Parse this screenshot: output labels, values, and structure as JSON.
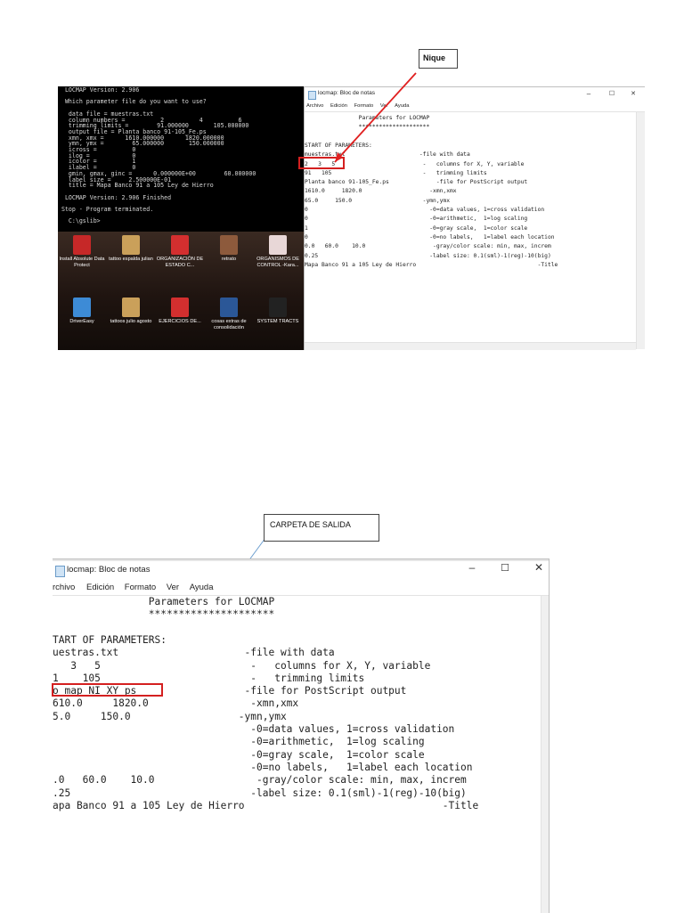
{
  "top_screenshot": {
    "console": {
      "lines": [
        "  LOCMAP Version: 2.906",
        "",
        "  Which parameter file do you want to use?",
        "",
        "   data file = muestras.txt",
        "   column numbers =          2          4          6",
        "   trimming limits =        91.000000       105.000000",
        "   output file = Planta banco 91-105_Fe.ps",
        "   xmn, xmx =      1610.000000      1820.000000",
        "   ymn, ymx =        65.000000       150.000000",
        "   icross =          0",
        "   ilog =            0",
        "   icolor =          1",
        "   ilabel =          0",
        "   gmin, gmax, ginc =      0.000000E+00        60.000000",
        "   label size =     2.500000E-01",
        "   title = Mapa Banco 91 a 105 Ley de Hierro",
        "",
        "  LOCMAP Version: 2.906 Finished",
        "",
        " Stop - Program terminated.",
        "",
        "   C:\\gslib>"
      ]
    },
    "desktop_icons": [
      {
        "label": "Install Absolute Data Protect",
        "color": "#c62828",
        "icon": "app-icon"
      },
      {
        "label": "tattoo espalda julian",
        "color": "#caa05a",
        "icon": "folder-archive-icon"
      },
      {
        "label": "ORGANIZACIÓN DE ESTADO C...",
        "color": "#d32f2f",
        "icon": "pdf-icon"
      },
      {
        "label": "retrato",
        "color": "#8d5a3c",
        "icon": "image-icon"
      },
      {
        "label": "ORGANISMOS DE CONTROL -Kara...",
        "color": "#e8d7d7",
        "icon": "image-icon"
      },
      {
        "label": "DriverEasy",
        "color": "#3d8bd6",
        "icon": "app-icon"
      },
      {
        "label": "tattoos julio agosto",
        "color": "#caa05a",
        "icon": "folder-archive-icon"
      },
      {
        "label": "EJERCICIOS DE...",
        "color": "#d32f2f",
        "icon": "pdf-icon"
      },
      {
        "label": "cosas extras de consolidación",
        "color": "#2b5797",
        "icon": "word-doc-icon"
      },
      {
        "label": "SYSTEM TRACTS",
        "color": "#222222",
        "icon": "image-icon"
      }
    ],
    "notepad": {
      "title": "locmap: Bloc de notas",
      "menu": [
        "Archivo",
        "Edición",
        "Formato",
        "Ver",
        "Ayuda"
      ],
      "controls": [
        "–",
        "☐",
        "✕"
      ],
      "lines": [
        "                Parameters for LOCMAP",
        "                *********************",
        "",
        "START OF PARAMETERS:",
        "muestras.txt                      -file with data",
        "2   3   5                          -   columns for X, Y, variable",
        "91   105                           -   trimming limits",
        "Planta banco 91-105_Fe.ps              -file for PostScript output",
        "1610.0     1820.0                    -xmn,xmx",
        "65.0     150.0                     -ymn,ymx",
        "0                                    -0=data values, 1=cross validation",
        "0                                    -0=arithmetic,  1=log scaling",
        "1                                    -0=gray scale,  1=color scale",
        "0                                    -0=no labels,   1=label each location",
        "0.0   60.0    10.0                    -gray/color scale: min, max, increm",
        "0.25                                 -label size: 0.1(sml)-1(reg)-10(big)",
        "Mapa Banco 91 a 105 Ley de Hierro                                    -Title"
      ]
    },
    "callout": "Nique"
  },
  "bottom_screenshot": {
    "notepad": {
      "title": "locmap: Bloc de notas",
      "menu": [
        "rchivo",
        "Edición",
        "Formato",
        "Ver",
        "Ayuda"
      ],
      "controls": [
        "–",
        "☐",
        "✕"
      ],
      "lines": [
        "                Parameters for LOCMAP",
        "                *********************",
        "",
        "TART OF PARAMETERS:",
        "uestras.txt                     -file with data",
        "   3   5                         -   columns for X, Y, variable",
        "1    105                         -   trimming limits",
        "o map NI XY ps                  -file for PostScript output",
        "610.0     1820.0                 -xmn,xmx",
        "5.0     150.0                  -ymn,ymx",
        "                                 -0=data values, 1=cross validation",
        "                                 -0=arithmetic,  1=log scaling",
        "                                 -0=gray scale,  1=color scale",
        "                                 -0=no labels,   1=label each location",
        ".0   60.0    10.0                 -gray/color scale: min, max, increm",
        ".25                              -label size: 0.1(sml)-1(reg)-10(big)",
        "apa Banco 91 a 105 Ley de Hierro                                 -Title"
      ]
    },
    "callout": "CARPETA DE SALIDA"
  }
}
